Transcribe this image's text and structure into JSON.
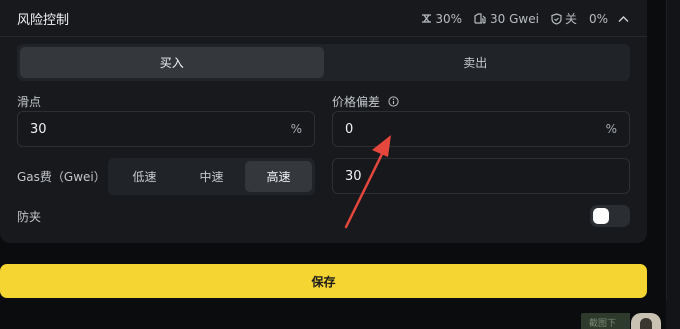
{
  "header": {
    "title": "风险控制",
    "stats": {
      "slippage": "30%",
      "gas": "30 Gwei",
      "anti_mev": "关",
      "deviation": "0%"
    }
  },
  "trade_side": {
    "buy_label": "买入",
    "sell_label": "卖出",
    "selected": "买入"
  },
  "slippage": {
    "label": "滑点",
    "value": "30",
    "unit": "%"
  },
  "price_deviation": {
    "label": "价格偏差",
    "value": "0",
    "unit": "%"
  },
  "gas": {
    "label": "Gas费（Gwei）",
    "options": [
      "低速",
      "中速",
      "高速"
    ],
    "selected": "高速",
    "value": "30"
  },
  "anti_sandwich": {
    "label": "防夹",
    "enabled": false
  },
  "save_label": "保存",
  "corner_badge": "截图下",
  "colors": {
    "accent": "#f5d531",
    "annotation_arrow": "#e5473d",
    "panel_bg": "#17191c"
  }
}
